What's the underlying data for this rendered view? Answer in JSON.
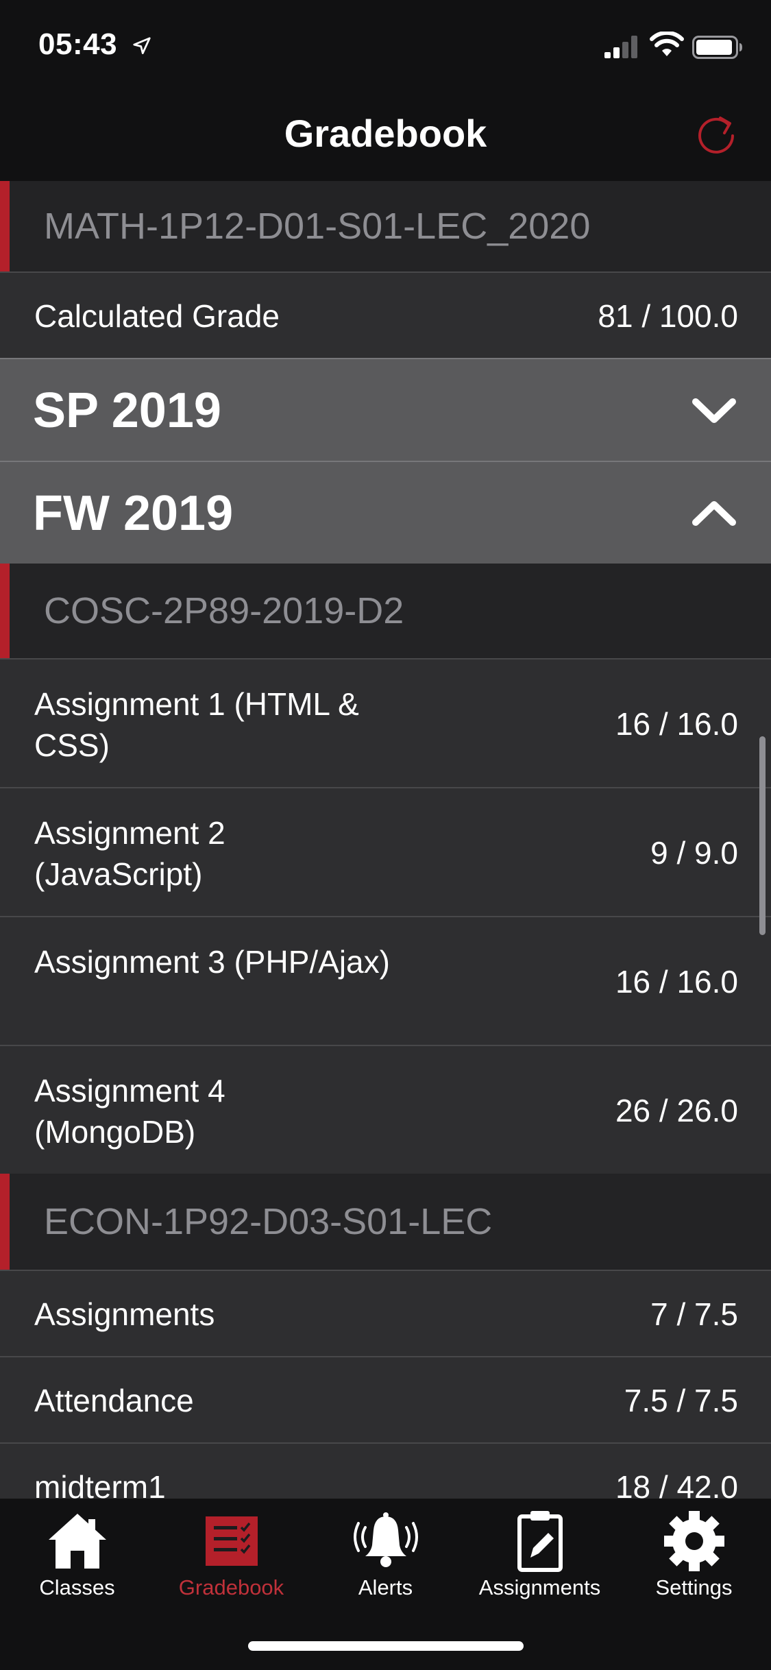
{
  "status_bar": {
    "time": "05:43"
  },
  "nav": {
    "title": "Gradebook"
  },
  "sections": {
    "math": {
      "course": "MATH-1P12-D01-S01-LEC_2020",
      "rows": [
        {
          "label": "Calculated Grade",
          "value": "81 / 100.0"
        }
      ]
    },
    "terms": [
      {
        "label": "SP 2019",
        "expanded": false
      },
      {
        "label": "FW 2019",
        "expanded": true
      }
    ],
    "cosc": {
      "course": "COSC-2P89-2019-D2",
      "rows": [
        {
          "label": "Assignment 1 (HTML & CSS)",
          "value": "16 / 16.0"
        },
        {
          "label": "Assignment 2 (JavaScript)",
          "value": "9 / 9.0"
        },
        {
          "label": "Assignment 3 (PHP/Ajax)",
          "value": "16 / 16.0"
        },
        {
          "label": "Assignment 4 (MongoDB)",
          "value": "26 / 26.0"
        }
      ]
    },
    "econ": {
      "course": "ECON-1P92-D03-S01-LEC",
      "rows": [
        {
          "label": "Assignments",
          "value": "7 / 7.5"
        },
        {
          "label": "Attendance",
          "value": "7.5 / 7.5"
        },
        {
          "label": "midterm1",
          "value": "18 / 42.0"
        }
      ]
    }
  },
  "tabs": [
    {
      "label": "Classes",
      "icon": "home-icon",
      "active": false
    },
    {
      "label": "Gradebook",
      "icon": "gradebook-icon",
      "active": true
    },
    {
      "label": "Alerts",
      "icon": "bell-icon",
      "active": false
    },
    {
      "label": "Assignments",
      "icon": "clipboard-edit-icon",
      "active": false
    },
    {
      "label": "Settings",
      "icon": "gear-icon",
      "active": false
    }
  ],
  "colors": {
    "accent": "#b4202a",
    "active_tab": "#c0313a",
    "background": "#2c2c2e",
    "term_header": "#5a5a5c"
  }
}
